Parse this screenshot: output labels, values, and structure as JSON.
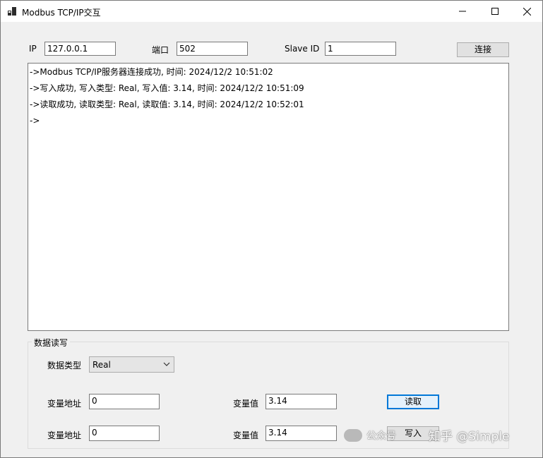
{
  "window": {
    "title": "Modbus TCP/IP交互"
  },
  "connection": {
    "ip_label": "IP",
    "ip_value": "127.0.0.1",
    "port_label": "端口",
    "port_value": "502",
    "slave_label": "Slave ID",
    "slave_value": "1",
    "connect_label": "连接"
  },
  "log": {
    "lines": [
      "->Modbus TCP/IP服务器连接成功, 时间: 2024/12/2 10:51:02",
      "->写入成功, 写入类型: Real, 写入值: 3.14, 时间: 2024/12/2 10:51:09",
      "->读取成功, 读取类型: Real, 读取值: 3.14, 时间: 2024/12/2 10:52:01",
      "->"
    ]
  },
  "data_group": {
    "title": "数据读写",
    "type_label": "数据类型",
    "type_value": "Real",
    "rows": [
      {
        "addr_label": "变量地址",
        "addr_value": "0",
        "value_label": "变量值",
        "value_value": "3.14",
        "button_label": "读取"
      },
      {
        "addr_label": "变量地址",
        "addr_value": "0",
        "value_label": "变量值",
        "value_value": "3.14",
        "button_label": "写入"
      }
    ]
  },
  "watermark": {
    "left": "公众号",
    "right": "知乎 @Simple"
  }
}
